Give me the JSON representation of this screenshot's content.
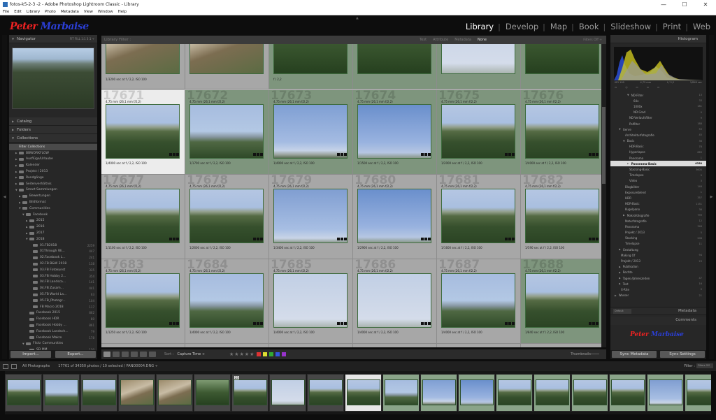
{
  "window": {
    "title": "fotos-k5-2-3 -2 - Adobe Photoshop Lightroom Classic - Library",
    "controls": [
      "—",
      "☐",
      "✕"
    ]
  },
  "menu": [
    "File",
    "Edit",
    "Library",
    "Photo",
    "Metadata",
    "View",
    "Window",
    "Help"
  ],
  "identity": {
    "first": "Peter",
    "last": "Marbaise"
  },
  "modules": [
    {
      "label": "Library",
      "active": true
    },
    {
      "label": "Develop",
      "active": false
    },
    {
      "label": "Map",
      "active": false
    },
    {
      "label": "Book",
      "active": false
    },
    {
      "label": "Slideshow",
      "active": false
    },
    {
      "label": "Print",
      "active": false
    },
    {
      "label": "Web",
      "active": false
    }
  ],
  "left": {
    "navigator": {
      "title": "Navigator",
      "options": "FIT  FILL  1:1  3:1 ÷"
    },
    "catalog": "Catalog",
    "folders": "Folders",
    "collections": "Collections",
    "collection_items": [
      {
        "label": "Filter Collections",
        "count": "",
        "indent": 1,
        "sel": true,
        "arrow": "",
        "folder": false
      },
      {
        "label": "BBWORKFLOW",
        "count": "",
        "indent": 1,
        "arrow": "▶",
        "folder": true
      },
      {
        "label": "Ausflüge/Urlaube",
        "count": "",
        "indent": 1,
        "arrow": "▶",
        "folder": true
      },
      {
        "label": "Kalender",
        "count": "",
        "indent": 1,
        "arrow": "▶",
        "folder": true
      },
      {
        "label": "Projekt / 2013",
        "count": "",
        "indent": 1,
        "arrow": "▶",
        "folder": true
      },
      {
        "label": "Rundgänge",
        "count": "",
        "indent": 1,
        "arrow": "▶",
        "folder": true
      },
      {
        "label": "Seitenverhältnis",
        "count": "",
        "indent": 1,
        "arrow": "▶",
        "folder": true
      },
      {
        "label": "Smart Sammlungen",
        "count": "",
        "indent": 1,
        "arrow": "▼",
        "folder": true
      },
      {
        "label": "Bewertungen",
        "count": "",
        "indent": 2,
        "arrow": "▶",
        "folder": true
      },
      {
        "label": "Bildformat",
        "count": "",
        "indent": 2,
        "arrow": "▶",
        "folder": true
      },
      {
        "label": "Communities",
        "count": "",
        "indent": 2,
        "arrow": "▼",
        "folder": true
      },
      {
        "label": "Facebook",
        "count": "",
        "indent": 3,
        "arrow": "▼",
        "folder": true
      },
      {
        "label": "2015",
        "count": "",
        "indent": 4,
        "arrow": "▶",
        "folder": true
      },
      {
        "label": "2016",
        "count": "",
        "indent": 4,
        "arrow": "▶",
        "folder": true
      },
      {
        "label": "2017",
        "count": "",
        "indent": 4,
        "arrow": "▶",
        "folder": true
      },
      {
        "label": "2018",
        "count": "",
        "indent": 4,
        "arrow": "▼",
        "folder": true
      },
      {
        "label": "01.FB2018",
        "count": "2259",
        "indent": 5,
        "arrow": "",
        "folder": true
      },
      {
        "label": "01Through Wi...",
        "count": "447",
        "indent": 5,
        "arrow": "",
        "folder": true
      },
      {
        "label": "02.Facebook L...",
        "count": "241",
        "indent": 5,
        "arrow": "",
        "folder": true
      },
      {
        "label": "02.FB B&W 2018",
        "count": "138",
        "indent": 5,
        "arrow": "",
        "folder": true
      },
      {
        "label": "03.FB Fotokunst",
        "count": "335",
        "indent": 5,
        "arrow": "",
        "folder": true
      },
      {
        "label": "03.FB Hobby 2...",
        "count": "354",
        "indent": 5,
        "arrow": "",
        "folder": true
      },
      {
        "label": "04.FB Landsca...",
        "count": "141",
        "indent": 5,
        "arrow": "",
        "folder": true
      },
      {
        "label": "04.FB Zusam...",
        "count": "441",
        "indent": 5,
        "arrow": "",
        "folder": true
      },
      {
        "label": "05.FB World La...",
        "count": "63",
        "indent": 5,
        "arrow": "",
        "folder": true
      },
      {
        "label": "05.FB_Photogr...",
        "count": "104",
        "indent": 5,
        "arrow": "",
        "folder": true
      },
      {
        "label": "FB Macro 2018",
        "count": "117",
        "indent": 5,
        "arrow": "",
        "folder": true
      },
      {
        "label": "Facebook 2015",
        "count": "862",
        "indent": 4,
        "arrow": "",
        "folder": true
      },
      {
        "label": "Facebook HDR",
        "count": "80",
        "indent": 4,
        "arrow": "",
        "folder": true
      },
      {
        "label": "Facebook Hobby ...",
        "count": "861",
        "indent": 4,
        "arrow": "",
        "folder": true
      },
      {
        "label": "Facebook Landsch...",
        "count": "79",
        "indent": 4,
        "arrow": "",
        "folder": true
      },
      {
        "label": "Facebook Makro",
        "count": "178",
        "indent": 4,
        "arrow": "",
        "folder": true
      },
      {
        "label": "Flickr Communities",
        "count": "",
        "indent": 3,
        "arrow": "▼",
        "folder": true
      },
      {
        "label": "SD MM",
        "count": "130",
        "indent": 4,
        "arrow": "",
        "folder": true
      }
    ],
    "import_label": "Import...",
    "export_label": "Export..."
  },
  "center": {
    "filter_label": "Library Filter :",
    "filter_options": [
      {
        "label": "Text",
        "on": false
      },
      {
        "label": "Attribute",
        "on": false
      },
      {
        "label": "Metadata",
        "on": false
      },
      {
        "label": "None",
        "on": true
      }
    ],
    "filters_off": "Filters Off ÷",
    "top_row": [
      {
        "bot": "1/3200 sec at f / 2,2, ISO 100",
        "ph": "ph-aerial",
        "cls": ""
      },
      {
        "bot": "",
        "ph": "ph-aerial",
        "cls": ""
      },
      {
        "bot": "f / 2,2",
        "ph": "ph-dark",
        "cls": "sel"
      },
      {
        "bot": "",
        "ph": "ph-dark",
        "cls": "sel"
      },
      {
        "bot": "",
        "ph": "ph-haze",
        "cls": "sel"
      },
      {
        "bot": "",
        "ph": "ph-dark",
        "cls": "sel"
      }
    ],
    "rows": [
      [
        {
          "n": "17671",
          "top": "4,75 mm (26,1 mm f/2,2)",
          "bot": "1/4000 sec at f / 2,2, ISO 100",
          "ph": "ph-forest",
          "cls": "first"
        },
        {
          "n": "17672",
          "top": "4,75 mm (26,1 mm f/2,2)",
          "bot": "1/1700 sec at f / 2,2, ISO 100",
          "ph": "ph-mix",
          "cls": "sel"
        },
        {
          "n": "17673",
          "top": "4,75 mm (26,1 mm f/2,2)",
          "bot": "1/4000 sec at f / 2,2, ISO 100",
          "ph": "ph-sky",
          "cls": "sel"
        },
        {
          "n": "17674",
          "top": "4,75 mm (26,1 mm f/2,2)",
          "bot": "1/1500 sec at f / 2,2, ISO 100",
          "ph": "ph-deep",
          "cls": "sel"
        },
        {
          "n": "17675",
          "top": "4,75 mm (26,1 mm f/2,2)",
          "bot": "1/2000 sec at f / 2,2, ISO 100",
          "ph": "ph-forest",
          "cls": "sel"
        },
        {
          "n": "17676",
          "top": "4,75 mm (26,1 mm f/2,2)",
          "bot": "1/4000 sec at f / 2,2, ISO 100",
          "ph": "ph-forest",
          "cls": "sel"
        }
      ],
      [
        {
          "n": "17677",
          "top": "4,75 mm (26,1 mm f/2,2)",
          "bot": "1/1100 sec at f / 2,2, ISO 100",
          "ph": "ph-forest",
          "cls": ""
        },
        {
          "n": "17678",
          "top": "4,75 mm (26,1 mm f/2,2)",
          "bot": "1/2600 sec at f / 2,2, ISO 100",
          "ph": "ph-forest",
          "cls": ""
        },
        {
          "n": "17679",
          "top": "4,75 mm (26,1 mm f/2,2)",
          "bot": "1/3400 sec at f / 2,2, ISO 100",
          "ph": "ph-sky2",
          "cls": ""
        },
        {
          "n": "17680",
          "top": "4,75 mm (26,1 mm f/2,2)",
          "bot": "1/2900 sec at f / 2,2, ISO 100",
          "ph": "ph-deep",
          "cls": ""
        },
        {
          "n": "17681",
          "top": "4,75 mm (26,1 mm f/2,2)",
          "bot": "1/1600 sec at f / 2,2, ISO 100",
          "ph": "ph-forest",
          "cls": ""
        },
        {
          "n": "17682",
          "top": "4,75 mm (26,1 mm f/2,2)",
          "bot": "1/590 sec at f / 2,2, ISO 100",
          "ph": "ph-forest",
          "cls": ""
        }
      ],
      [
        {
          "n": "17683",
          "top": "4,75 mm (26,1 mm f/2,2)",
          "bot": "1/1250 sec at f / 2,2, ISO 100",
          "ph": "ph-forest",
          "cls": ""
        },
        {
          "n": "17684",
          "top": "4,75 mm (26,1 mm f/2,2)",
          "bot": "1/4000 sec at f / 2,2, ISO 100",
          "ph": "ph-mix",
          "cls": ""
        },
        {
          "n": "17685",
          "top": "4,75 mm (26,1 mm f/2,2)",
          "bot": "1/4000 sec at f / 2,2, ISO 100",
          "ph": "ph-haze",
          "cls": ""
        },
        {
          "n": "17686",
          "top": "4,75 mm (26,1 mm f/2,2)",
          "bot": "1/4000 sec at f / 2,2, ISO 100",
          "ph": "ph-haze",
          "cls": ""
        },
        {
          "n": "17687",
          "top": "4,75 mm (26,1 mm f/2,2)",
          "bot": "1/4000 sec at f / 2,2, ISO 100",
          "ph": "ph-mix",
          "cls": ""
        },
        {
          "n": "17688",
          "top": "4,75 mm (26,1 mm f/2,2)",
          "bot": "1/840 sec at f / 2,2, ISO 100",
          "ph": "ph-forest",
          "cls": "sel"
        }
      ]
    ],
    "toolbar": {
      "sort_label": "Sort :",
      "sort_value": "Capture Time ÷",
      "stars": "★★★★★",
      "thumbnails": "Thumbnails",
      "label_colors": [
        "#d33",
        "#dd3",
        "#3a3",
        "#35d",
        "#93c"
      ]
    }
  },
  "right": {
    "histogram_title": "Histogram",
    "hist_info": [
      "ISO 100",
      "4,75 mm",
      "f / 2,2",
      "1/840 sec"
    ],
    "hist_tools": [
      "▭",
      "◎",
      "▭",
      "▭",
      "▭"
    ],
    "keywords": [
      {
        "label": "ND-Filter",
        "count": "13",
        "indent": 3,
        "arrow": "▼"
      },
      {
        "label": "64x",
        "count": "33",
        "indent": 4,
        "arrow": ""
      },
      {
        "label": "1000x",
        "count": "181",
        "indent": 4,
        "arrow": ""
      },
      {
        "label": "ND Grad",
        "count": "0",
        "indent": 4,
        "arrow": ""
      },
      {
        "label": "ND-Verlaufsfilter",
        "count": "9",
        "indent": 3,
        "arrow": ""
      },
      {
        "label": "Polfilter",
        "count": "188",
        "indent": 3,
        "arrow": ""
      },
      {
        "label": "Genre",
        "count": "53",
        "indent": 1,
        "arrow": "▼"
      },
      {
        "label": "Architekturfotografie",
        "count": "45",
        "indent": 2,
        "arrow": ""
      },
      {
        "label": "Basic",
        "count": "36",
        "indent": 2,
        "arrow": "▼"
      },
      {
        "label": "HDR-Basic",
        "count": "78",
        "indent": 3,
        "arrow": ""
      },
      {
        "label": "Hyperlapse",
        "count": "869",
        "indent": 3,
        "arrow": ""
      },
      {
        "label": "Panorama",
        "count": "1",
        "indent": 3,
        "arrow": ""
      },
      {
        "label": "Panorama-Basic",
        "count": "6358",
        "indent": 3,
        "arrow": "▶",
        "sel": true
      },
      {
        "label": "Stacking-Basic",
        "count": "3605",
        "indent": 3,
        "arrow": ""
      },
      {
        "label": "Timelapse",
        "count": "9",
        "indent": 3,
        "arrow": ""
      },
      {
        "label": "Video",
        "count": "3",
        "indent": 3,
        "arrow": ""
      },
      {
        "label": "Blogbilder",
        "count": "146",
        "indent": 2,
        "arrow": ""
      },
      {
        "label": "Exposureblend",
        "count": "1",
        "indent": 2,
        "arrow": ""
      },
      {
        "label": "HDR",
        "count": "357",
        "indent": 2,
        "arrow": ""
      },
      {
        "label": "HDR-Basic",
        "count": "1151",
        "indent": 2,
        "arrow": ""
      },
      {
        "label": "Kugelpano",
        "count": "36",
        "indent": 2,
        "arrow": ""
      },
      {
        "label": "Makrofotografie",
        "count": "799",
        "indent": 2,
        "arrow": "▶"
      },
      {
        "label": "Naturfotografie",
        "count": "12",
        "indent": 2,
        "arrow": ""
      },
      {
        "label": "Panorama",
        "count": "346",
        "indent": 2,
        "arrow": ""
      },
      {
        "label": "Projekt / 2013",
        "count": "5",
        "indent": 2,
        "arrow": ""
      },
      {
        "label": "Stacking",
        "count": "208",
        "indent": 2,
        "arrow": ""
      },
      {
        "label": "Timelapse",
        "count": "11",
        "indent": 2,
        "arrow": ""
      },
      {
        "label": "Gestaltung",
        "count": "",
        "indent": 1,
        "arrow": "▶"
      },
      {
        "label": "Making Of",
        "count": "94",
        "indent": 1,
        "arrow": ""
      },
      {
        "label": "Projekt / 2013",
        "count": "23",
        "indent": 1,
        "arrow": ""
      },
      {
        "label": "Publikation",
        "count": "",
        "indent": 1,
        "arrow": "▶"
      },
      {
        "label": "Rechte",
        "count": "",
        "indent": 1,
        "arrow": "▶"
      },
      {
        "label": "Tages-/Jahreszeiten",
        "count": "47",
        "indent": 1,
        "arrow": "▶"
      },
      {
        "label": "Test",
        "count": "16",
        "indent": 1,
        "arrow": "▶"
      },
      {
        "label": "X-Rite",
        "count": "0",
        "indent": 1,
        "arrow": ""
      },
      {
        "label": "Wasser",
        "count": "21",
        "indent": 0,
        "arrow": "▶"
      }
    ],
    "default_label": "Default",
    "metadata": "Metadata",
    "comments": "Comments",
    "sync_metadata": "Sync Metadata",
    "sync_settings": "Sync Settings"
  },
  "filmstrip": {
    "source": "All Photographs",
    "status": "17761 of 34350 photos / 10 selected / PANO0004.DNG ÷",
    "filter_label": "Filter :",
    "filter_value": "Filters Off",
    "thumbs": [
      {
        "ph": "ph-forest",
        "cls": ""
      },
      {
        "ph": "ph-mix",
        "cls": ""
      },
      {
        "ph": "ph-forest",
        "cls": ""
      },
      {
        "ph": "ph-aerial",
        "cls": ""
      },
      {
        "ph": "ph-aerial",
        "cls": ""
      },
      {
        "ph": "ph-dark",
        "cls": ""
      },
      {
        "ph": "ph-forest",
        "cls": "",
        "num": "23"
      },
      {
        "ph": "ph-haze",
        "cls": ""
      },
      {
        "ph": "ph-forest",
        "cls": ""
      },
      {
        "ph": "ph-forest",
        "cls": "first"
      },
      {
        "ph": "ph-mix",
        "cls": "sel"
      },
      {
        "ph": "ph-sky",
        "cls": "sel"
      },
      {
        "ph": "ph-deep",
        "cls": "sel"
      },
      {
        "ph": "ph-forest",
        "cls": "sel"
      },
      {
        "ph": "ph-forest",
        "cls": "sel"
      },
      {
        "ph": "ph-forest",
        "cls": "sel"
      },
      {
        "ph": "ph-forest",
        "cls": "sel"
      },
      {
        "ph": "ph-sky2",
        "cls": "sel"
      },
      {
        "ph": "ph-forest",
        "cls": "sel"
      }
    ]
  }
}
